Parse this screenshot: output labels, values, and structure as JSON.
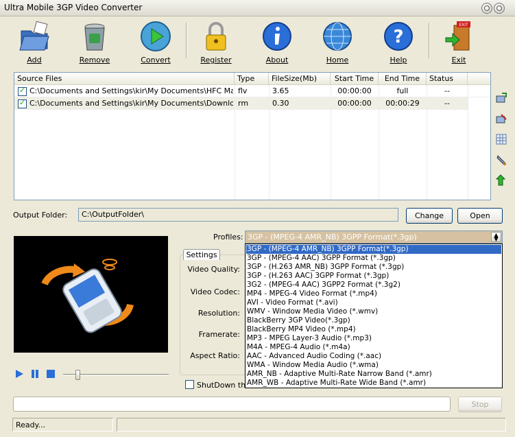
{
  "window": {
    "title": "Ultra Mobile 3GP Video Converter"
  },
  "toolbar": {
    "buttons": [
      {
        "id": "add",
        "label": "Add",
        "icon": "folder-add-icon"
      },
      {
        "id": "remove",
        "label": "Remove",
        "icon": "trash-can-icon"
      },
      {
        "id": "convert",
        "label": "Convert",
        "icon": "play-convert-icon"
      },
      {
        "id": "register",
        "label": "Register",
        "icon": "padlock-icon"
      },
      {
        "id": "about",
        "label": "About",
        "icon": "info-icon"
      },
      {
        "id": "home",
        "label": "Home",
        "icon": "globe-icon"
      },
      {
        "id": "help",
        "label": "Help",
        "icon": "question-icon"
      },
      {
        "id": "exit",
        "label": "Exit",
        "icon": "exit-door-icon"
      }
    ]
  },
  "file_list": {
    "columns": [
      "Source Files",
      "Type",
      "FileSize(Mb)",
      "Start Time",
      "End Time",
      "Status"
    ],
    "rows": [
      {
        "checked": true,
        "source": "C:\\Documents and Settings\\kir\\My Documents\\HFC Magnu...",
        "type": "flv",
        "size": "3.65",
        "start": "00:00:00",
        "end": "full",
        "status": "--"
      },
      {
        "checked": true,
        "source": "C:\\Documents and Settings\\kir\\My Documents\\Downloads\\...",
        "type": "rm",
        "size": "0.30",
        "start": "00:00:00",
        "end": "00:00:29",
        "status": "--"
      }
    ]
  },
  "side_icons": [
    "add-row-icon",
    "remove-row-icon",
    "grid-icon",
    "wrench-icon",
    "green-arrow-icon"
  ],
  "output": {
    "label": "Output Folder:",
    "value": "C:\\OutputFolder\\",
    "change_label": "Change",
    "open_label": "Open"
  },
  "profiles": {
    "label": "Profiles:",
    "selected": "3GP - (MPEG-4 AMR_NB) 3GPP Format(*.3gp)",
    "options": [
      "3GP - (MPEG-4 AMR_NB) 3GPP Format(*.3gp)",
      "3GP - (MPEG-4 AAC) 3GPP Format (*.3gp)",
      "3GP - (H.263 AMR_NB) 3GPP Format (*.3gp)",
      "3GP - (H.263 AAC) 3GPP Format (*.3gp)",
      "3G2 - (MPEG-4 AAC) 3GPP2 Format (*.3g2)",
      "MP4 - MPEG-4 Video Format (*.mp4)",
      "AVI - Video Format (*.avi)",
      "WMV - Window Media Video (*.wmv)",
      "BlackBerry 3GP Video(*.3gp)",
      "BlackBerry MP4 Video (*.mp4)",
      "MP3 - MPEG Layer-3 Audio (*.mp3)",
      "M4A - MPEG-4 Audio (*.m4a)",
      "AAC - Advanced Audio Coding (*.aac)",
      "WMA - Window Media Audio (*.wma)",
      "AMR_NB - Adaptive Multi-Rate Narrow Band (*.amr)",
      "AMR_WB - Adaptive Multi-Rate Wide Band (*.amr)"
    ]
  },
  "settings": {
    "tab_label": "Settings",
    "labels": [
      "Video Quality:",
      "Video Codec:",
      "Resolution:",
      "Framerate:",
      "Aspect Ratio:"
    ]
  },
  "shutdown_label": "ShutDown the",
  "stop_label": "Stop",
  "status": {
    "text": "Ready..."
  },
  "colors": {
    "selection": "#316ac5",
    "window_bg": "#ece9d8",
    "select_bg": "#d6c2a2"
  }
}
